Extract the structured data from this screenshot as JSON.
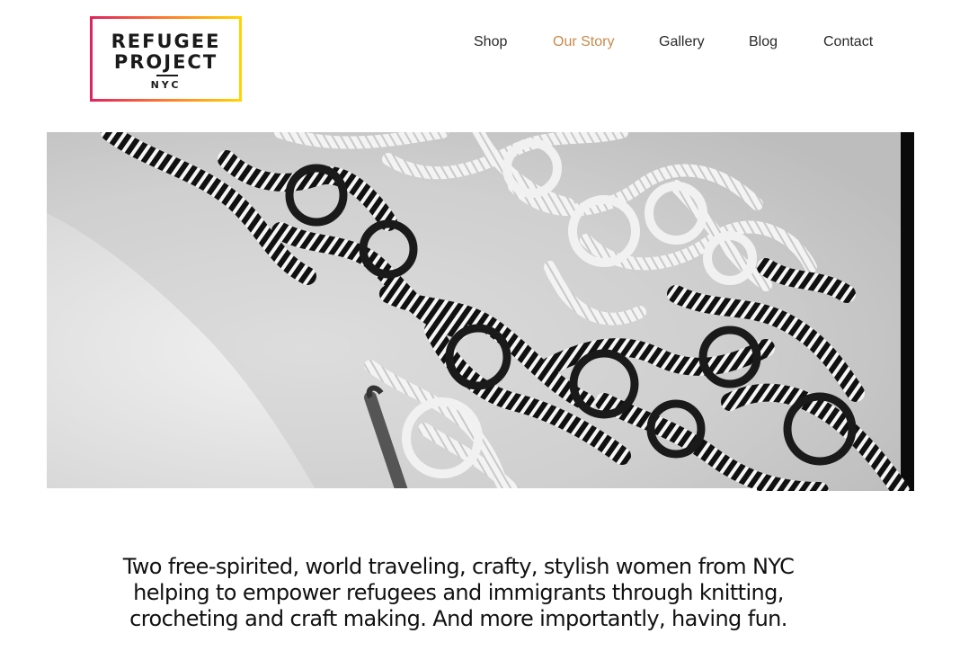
{
  "logo": {
    "line1": "REFUGEE",
    "line2": "PROJECT",
    "line3": "NYC",
    "gradient_colors": [
      "#e0245e",
      "#ff7a2e",
      "#ffd500"
    ]
  },
  "nav": {
    "items": [
      {
        "label": "Shop",
        "active": false
      },
      {
        "label": "Our Story",
        "active": true
      },
      {
        "label": "Gallery",
        "active": false
      },
      {
        "label": "Blog",
        "active": false
      },
      {
        "label": "Contact",
        "active": false
      }
    ],
    "active_color": "#c98a4b",
    "text_color": "#2a2a2a"
  },
  "hero": {
    "style": "black-and-white"
  },
  "tagline": {
    "text": "Two free-spirited, world traveling, crafty, stylish women from NYC helping to empower refugees and immigrants through knitting, crocheting and craft making. And more importantly, having fun."
  }
}
